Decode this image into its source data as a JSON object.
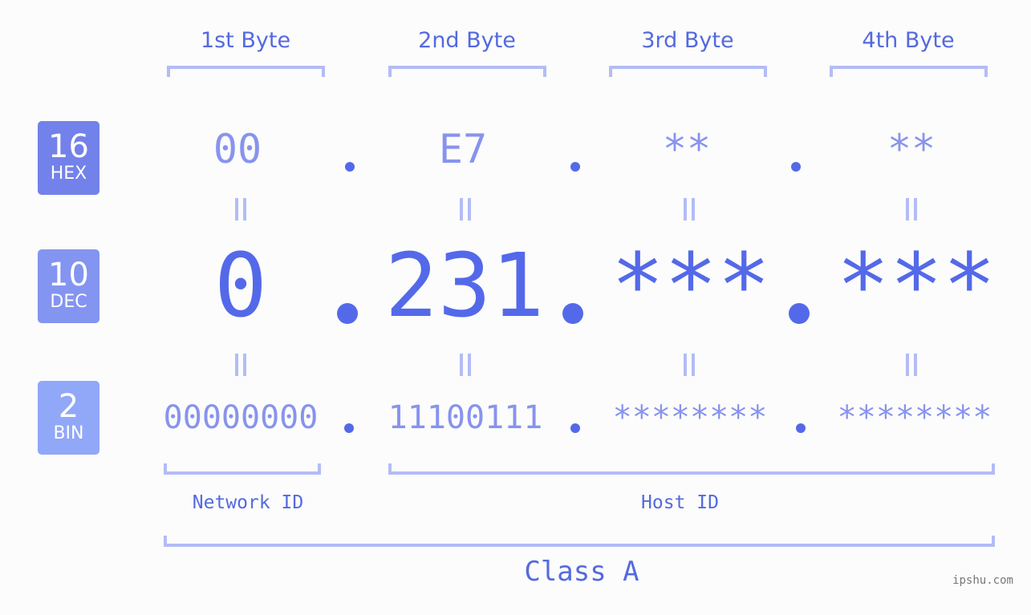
{
  "ip_address": "0.231.*.*",
  "bytes": [
    {
      "header": "1st Byte",
      "hex": "00",
      "dec": "0",
      "bin": "00000000"
    },
    {
      "header": "2nd Byte",
      "hex": "E7",
      "dec": "231",
      "bin": "11100111"
    },
    {
      "header": "3rd Byte",
      "hex": "**",
      "dec": "***",
      "bin": "********"
    },
    {
      "header": "4th Byte",
      "hex": "**",
      "dec": "***",
      "bin": "********"
    }
  ],
  "bases": [
    {
      "num": "16",
      "name": "HEX",
      "color": "#7381ea"
    },
    {
      "num": "10",
      "name": "DEC",
      "color": "#8494f1"
    },
    {
      "num": "2",
      "name": "BIN",
      "color": "#91a7f8"
    }
  ],
  "segments": {
    "network_id": "Network ID",
    "host_id": "Host ID",
    "class": "Class A"
  },
  "watermark": "ipshu.com",
  "colors": {
    "accent": "#5469e9",
    "text_light": "#8893ee",
    "bracket": "#b3bcf6",
    "background": "#fbfcfb"
  }
}
